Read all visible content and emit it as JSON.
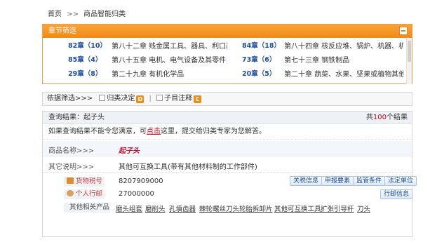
{
  "breadcrumb": {
    "home": "首页",
    "sep": ">>",
    "current": "商品智能归类"
  },
  "chapter_panel": {
    "title": "章节筛选",
    "rows": [
      {
        "left_code": "82章（10）",
        "left_name": "第八十二章 贱金属工具、器具、利口器、餐",
        "right_code": "84章（18）",
        "right_name": "第八十四章 核反应堆、锅炉、机器、机械器"
      },
      {
        "left_code": "85章（4）",
        "left_name": "第八十五章 电机、电气设备及其零件；录音",
        "right_code": "73章（6）",
        "right_name": "第七十三章 钢铁制品"
      },
      {
        "left_code": "29章（8）",
        "left_name": "第二十九章 有机化学品",
        "right_code": "20章（5）",
        "right_name": "第二十章 蔬菜、水果、坚果或植物其他部分"
      }
    ]
  },
  "filter": {
    "label": "依据筛选>>>",
    "option1": "归类决定",
    "option1_tag": "D",
    "option2": "子目注释",
    "option2_tag": "C"
  },
  "result": {
    "query_label": "查询结果：",
    "query_value": "起子头",
    "count_prefix": "共",
    "count_num": "100",
    "count_suffix": "个结果",
    "note_pre": "如果查询结果不能令您满意，可",
    "note_link": "点击",
    "note_post": "这里，提交给归类专家为您解答。",
    "name_label": "商品名称>>>",
    "name_value": "起子头",
    "other_label": "其它说明>>>",
    "other_value": "其他可互换工具(带有其他材料制的工作部件)",
    "tax_label": "货物税号",
    "tax_value": "8207909000",
    "personal_label": "个人行邮",
    "personal_value": "27000000",
    "buttons": [
      "关税信息",
      "申报要素",
      "监管条件",
      "法定单位"
    ],
    "postal_button": "行邮信息",
    "related_label": "其他相关产品",
    "related": [
      "磨头组套",
      "磨削头",
      "孔填齿器",
      "棘轮螺丝刀头",
      "轮胎拆卸片",
      "其他可互换工具",
      "扩张引导杆",
      "刀头"
    ]
  }
}
